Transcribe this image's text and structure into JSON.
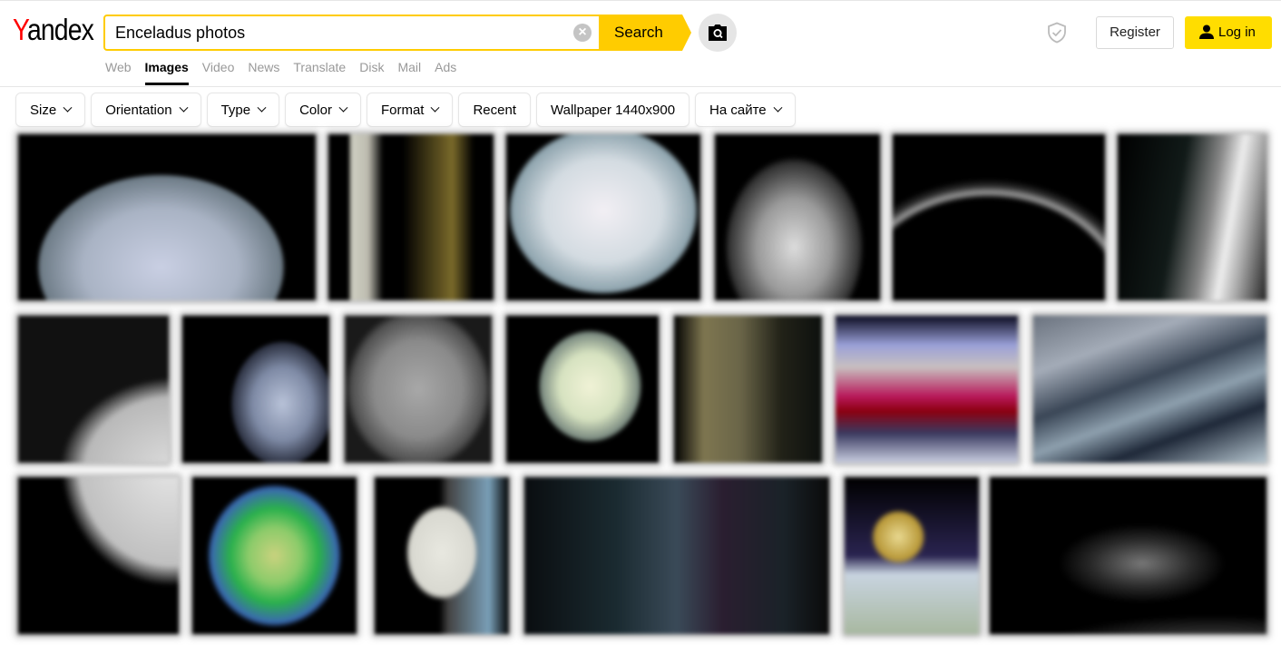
{
  "header": {
    "logo": {
      "first_letter": "Y",
      "rest": "andex"
    },
    "search": {
      "value": "Enceladus photos",
      "placeholder": "",
      "button_label": "Search"
    },
    "nav": [
      {
        "label": "Web",
        "active": false
      },
      {
        "label": "Images",
        "active": true
      },
      {
        "label": "Video",
        "active": false
      },
      {
        "label": "News",
        "active": false
      },
      {
        "label": "Translate",
        "active": false
      },
      {
        "label": "Disk",
        "active": false
      },
      {
        "label": "Mail",
        "active": false
      },
      {
        "label": "Ads",
        "active": false
      }
    ],
    "register_label": "Register",
    "login_label": "Log in"
  },
  "filters": [
    {
      "label": "Size",
      "dropdown": true
    },
    {
      "label": "Orientation",
      "dropdown": true
    },
    {
      "label": "Type",
      "dropdown": true
    },
    {
      "label": "Color",
      "dropdown": true
    },
    {
      "label": "Format",
      "dropdown": true
    },
    {
      "label": "Recent",
      "dropdown": false
    },
    {
      "label": "Wallpaper 1440x900",
      "dropdown": false
    },
    {
      "label": "На сайте",
      "dropdown": true
    }
  ],
  "colors": {
    "accent": "#ffcc00",
    "login_bg": "#ffdd00",
    "logo_red": "#ff0000"
  },
  "results": {
    "rows": [
      [
        {
          "desc": "blue-white enceladus half globe"
        },
        {
          "desc": "crescent enceladus with yellow tint"
        },
        {
          "desc": "pale white enceladus sphere"
        },
        {
          "desc": "grey enceladus upper half"
        },
        {
          "desc": "thin limb arc of enceladus"
        },
        {
          "desc": "plumes from south pole"
        }
      ],
      [
        {
          "desc": "grey enceladus quarter view"
        },
        {
          "desc": "blue-grey enceladus on black"
        },
        {
          "desc": "grayscale cratered enceladus"
        },
        {
          "desc": "pale yellow-green enceladus"
        },
        {
          "desc": "olive-toned enceladus"
        },
        {
          "desc": "enceladus false-color red band"
        },
        {
          "desc": "tiger stripes close-up"
        }
      ],
      [
        {
          "desc": "bright enceladus limb"
        },
        {
          "desc": "green false-color map globe"
        },
        {
          "desc": "enceladus with blue ring"
        },
        {
          "desc": "dark spectral image"
        },
        {
          "desc": "golden moon over icy surface"
        },
        {
          "desc": "faint plume in dark"
        }
      ]
    ]
  }
}
